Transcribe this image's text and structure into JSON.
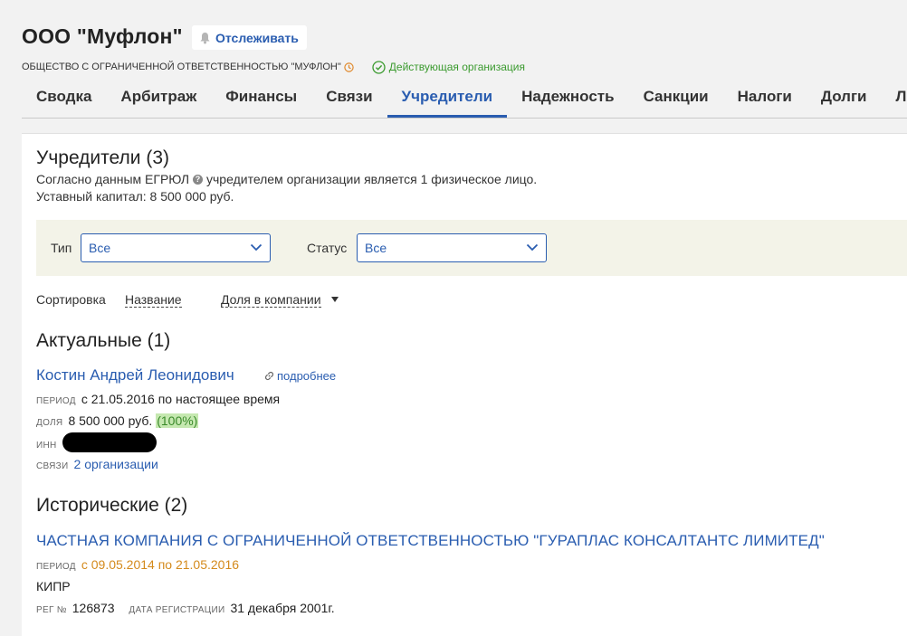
{
  "header": {
    "company_title": "ООО \"Муфлон\"",
    "watch_label": "Отслеживать",
    "full_name": "ОБЩЕСТВО С ОГРАНИЧЕННОЙ ОТВЕТСТВЕННОСТЬЮ \"МУФЛОН\"",
    "status": "Действующая организация"
  },
  "tabs": [
    "Сводка",
    "Арбитраж",
    "Финансы",
    "Связи",
    "Учредители",
    "Надежность",
    "Санкции",
    "Налоги",
    "Долги",
    "Лице"
  ],
  "active_tab": "Учредители",
  "founders": {
    "heading": "Учредители (3)",
    "egrul_prefix": "Согласно данным ЕГРЮЛ",
    "egrul_suffix": "учредителем организации является 1 физическое лицо.",
    "capital": "Уставный капитал: 8 500 000 руб."
  },
  "filters": {
    "type_label": "Тип",
    "type_value": "Все",
    "status_label": "Статус",
    "status_value": "Все"
  },
  "sort": {
    "label": "Сортировка",
    "by_name": "Название",
    "by_share": "Доля в компании"
  },
  "current": {
    "heading": "Актуальные (1)",
    "person": {
      "name": "Костин Андрей Леонидович",
      "more": "подробнее",
      "period_label": "период",
      "period": "с 21.05.2016 по настоящее время",
      "share_label": "доля",
      "share_amount": "8 500 000 руб.",
      "share_pct": "(100%)",
      "inn_label": "инн",
      "links_label": "связи",
      "links_value": "2 организации"
    }
  },
  "historical": {
    "heading": "Исторические (2)",
    "company": {
      "name": "ЧАСТНАЯ КОМПАНИЯ С ОГРАНИЧЕННОЙ ОТВЕТСТВЕННОСТЬЮ \"ГУРАПЛАС КОНСАЛТАНТС ЛИМИТЕД\"",
      "period_label": "период",
      "period": "с 09.05.2014 по 21.05.2016",
      "country": "КИПР",
      "reg_label": "рег №",
      "reg_no": "126873",
      "reg_date_label": "дата регистрации",
      "reg_date": "31 декабря 2001г."
    }
  },
  "colors": {
    "accent": "#2a5db0",
    "status_green": "#3a9a2e",
    "orange": "#d48a1c",
    "filter_bg": "#f3f3e8",
    "pct_bg": "#c5e8b0"
  },
  "icons": {
    "watch": "bell-icon",
    "clock": "clock-icon",
    "status": "check-circle-icon",
    "more": "link-icon",
    "help": "question-icon",
    "select": "chevron-down-icon",
    "sort": "caret-down-icon"
  }
}
